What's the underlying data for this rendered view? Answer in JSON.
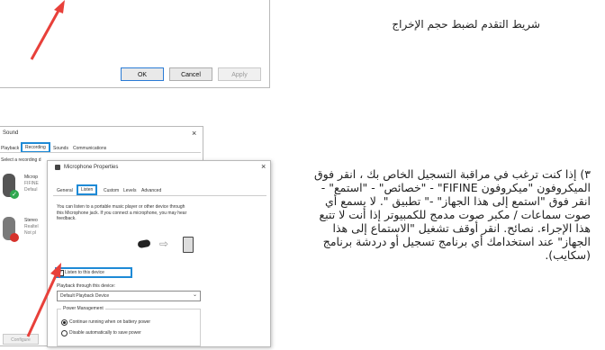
{
  "top_caption": "شريط التقدم لضبط حجم الإخراج",
  "upper_dialog": {
    "ok_label": "OK",
    "cancel_label": "Cancel",
    "apply_label": "Apply"
  },
  "sound_window": {
    "title": "Sound",
    "close": "×",
    "tabs": [
      "Playback",
      "Recording",
      "Sounds",
      "Communications"
    ],
    "instruction": "Select a recording d",
    "devices": [
      {
        "name": "Microp",
        "sub1": "FIFINE",
        "sub2": "Defaul"
      },
      {
        "name": "Stereo",
        "sub1": "Realtel",
        "sub2": "Not pl"
      }
    ],
    "configure_label": "Configure"
  },
  "mic_properties": {
    "title": "Microphone Properties",
    "close": "×",
    "tabs": [
      "General",
      "Listen",
      "Custom",
      "Levels",
      "Advanced"
    ],
    "description": "You can listen to a portable music player or other device through this Microphone jack. If you connect a microphone, you may hear feedback.",
    "listen_checkbox_label": "Listen to this device",
    "playback_label": "Playback through this device:",
    "playback_value": "Default Playback Device",
    "power_group_label": "Power Management",
    "power_option_1": "Continue running when on battery power",
    "power_option_2": "Disable automatically to save power"
  },
  "instructions_text": "٣) إذا كنت ترغب في مراقبة التسجيل الخاص بك ، انقر فوق الميكروفون \"ميكروفون FIFINE\" - \"خصائص\" - \"استمع\" - انقر فوق \"استمع إلى هذا الجهاز\" -\" تطبيق \". لا يسمع أي صوت سماعات / مكبر صوت مدمج للكمبيوتر إذا أنت لا تتبع هذا الإجراء. نصائح. انقر أوقف تشغيل \"الاستماع إلى هذا الجهاز\" عند استخدامك أي برنامج تسجيل أو دردشة برنامج (سكايب).",
  "colors": {
    "arrow": "#e8403a",
    "highlight": "#1e8ad6",
    "green_check": "#2fa84f",
    "red_status": "#d6312b"
  }
}
